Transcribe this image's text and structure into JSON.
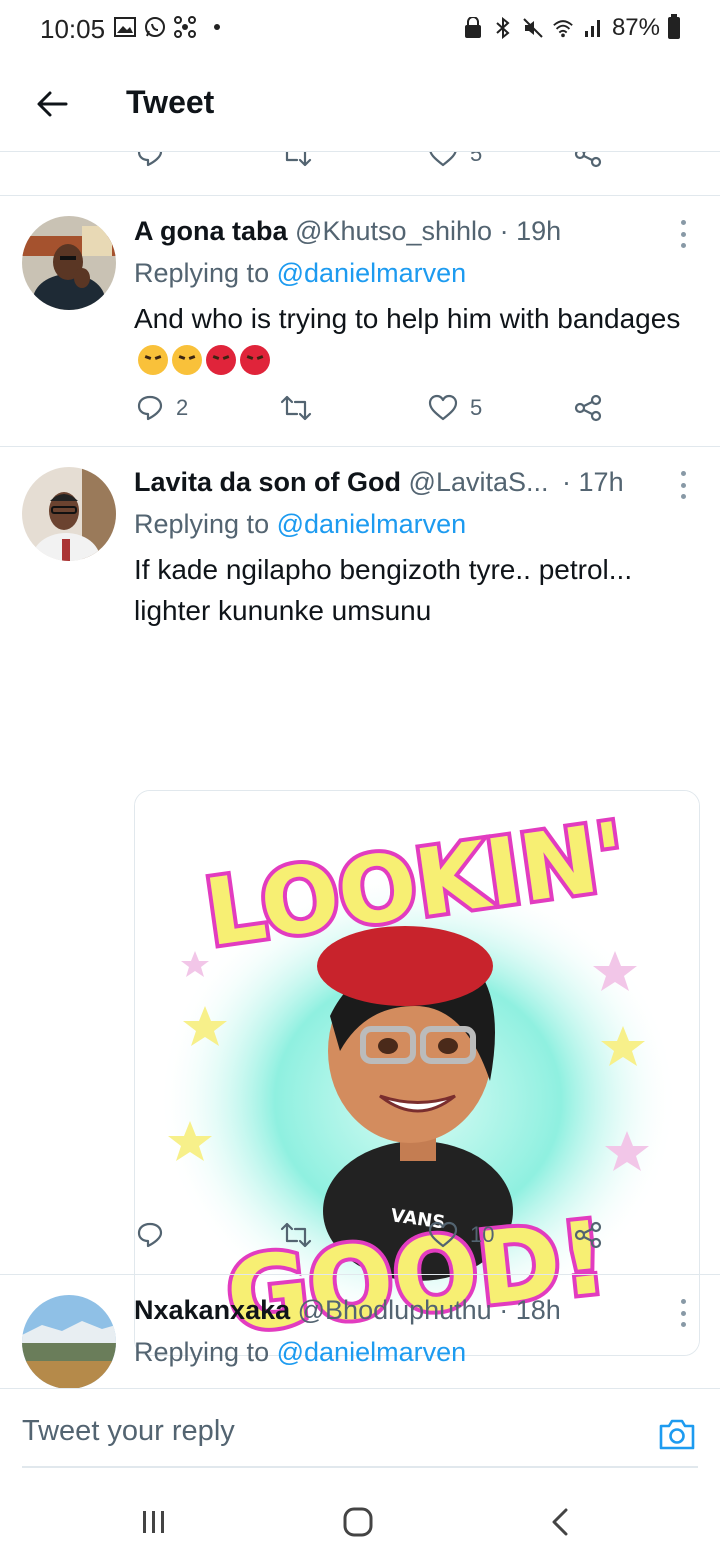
{
  "status_bar": {
    "time": "10:05",
    "battery": "87%",
    "left_icons": [
      "gallery-icon",
      "whatsapp-icon",
      "network-icon"
    ],
    "right_icons": [
      "lock-icon",
      "bluetooth-icon",
      "mute-icon",
      "wifi-icon",
      "signal-icon",
      "battery-icon"
    ]
  },
  "header": {
    "title": "Tweet"
  },
  "partial_tweet": {
    "likes": "5"
  },
  "tweets": [
    {
      "display_name": "A gona taba",
      "username": "@Khutso_shihlo",
      "time": "· 19h",
      "replying_prefix": "Replying to",
      "replying_to": "@danielmarven",
      "text": "And who is trying to help him with bandages",
      "emojis": [
        "angry-face-icon",
        "angry-face-icon",
        "pouting-face-icon",
        "pouting-face-icon"
      ],
      "replies": "2",
      "likes": "5"
    },
    {
      "display_name": "Lavita da son of God",
      "username": "@LavitaS...",
      "time": "· 17h",
      "replying_prefix": "Replying to",
      "replying_to": "@danielmarven",
      "text": "If kade ngilapho bengizoth tyre.. petrol... lighter kununke umsunu",
      "media": {
        "top_text": "LOOKIN'",
        "bottom_text": "GOOD!",
        "shirt_text": "VANS"
      },
      "likes": "10"
    },
    {
      "display_name": "Nxakanxaka",
      "username": "@Bhodluphuthu",
      "time": "· 18h",
      "replying_prefix": "Replying to",
      "replying_to": "@danielmarven"
    }
  ],
  "composer": {
    "placeholder": "Tweet your reply"
  },
  "colors": {
    "link": "#1d9bf0",
    "muted": "#536471",
    "text": "#0f1419",
    "divider": "#e1e8ed"
  }
}
